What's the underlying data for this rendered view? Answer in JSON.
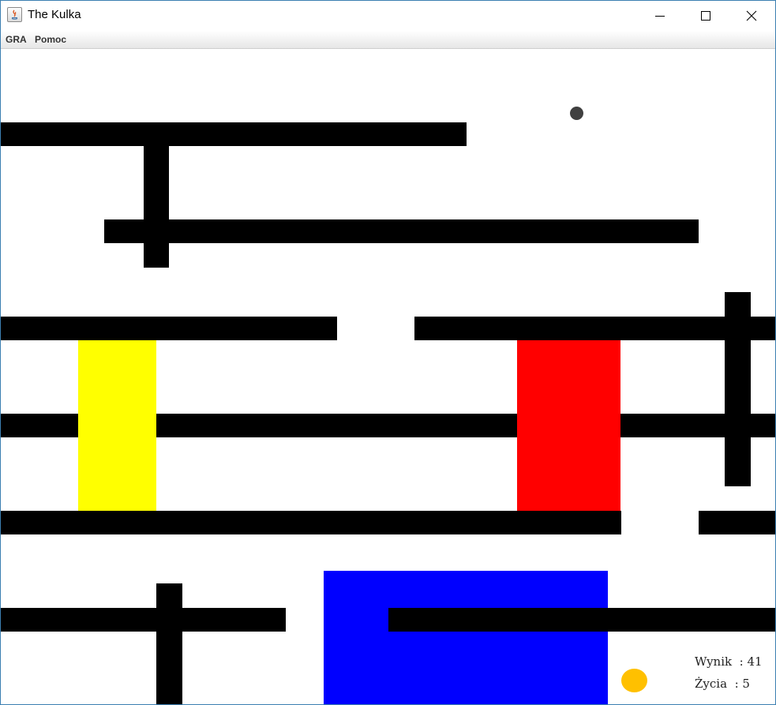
{
  "window": {
    "title": "The Kulka",
    "controls": [
      "minimize",
      "maximize",
      "close"
    ]
  },
  "menu": {
    "items": [
      "GRA",
      "Pomoc"
    ]
  },
  "game": {
    "score_label": "Wynik",
    "score_value": "41",
    "lives_label": "Życia",
    "lives_value": "5",
    "colors": {
      "wall": "#000000",
      "yellow_zone": "#ffff00",
      "red_zone": "#ff0000",
      "blue_zone": "#0000ff",
      "ball": "#404040",
      "target": "#ffc000"
    }
  }
}
